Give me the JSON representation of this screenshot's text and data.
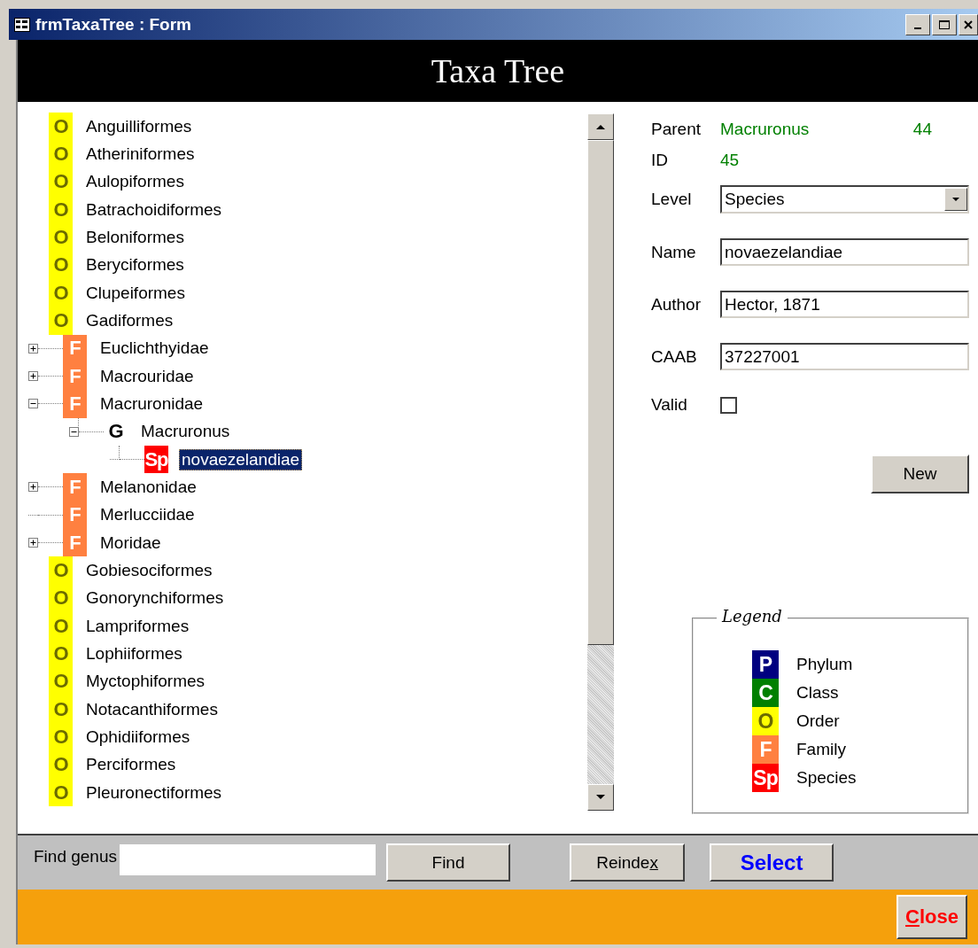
{
  "window": {
    "title": "frmTaxaTree : Form"
  },
  "header": {
    "title": "Taxa Tree"
  },
  "tree": {
    "items": [
      {
        "label": "Anguilliformes",
        "badge": "O",
        "color": "#ffff00",
        "selected": false
      },
      {
        "label": "Atheriniformes",
        "badge": "O",
        "color": "#ffff00",
        "selected": false
      },
      {
        "label": "Aulopiformes",
        "badge": "O",
        "color": "#ffff00",
        "selected": false
      },
      {
        "label": "Batrachoidiformes",
        "badge": "O",
        "color": "#ffff00",
        "selected": false
      },
      {
        "label": "Beloniformes",
        "badge": "O",
        "color": "#ffff00",
        "selected": false
      },
      {
        "label": "Beryciformes",
        "badge": "O",
        "color": "#ffff00",
        "selected": false
      },
      {
        "label": "Clupeiformes",
        "badge": "O",
        "color": "#ffff00",
        "selected": false
      },
      {
        "label": "Gadiformes",
        "badge": "O",
        "color": "#ffff00",
        "selected": false,
        "children": [
          {
            "label": "Euclichthyidae",
            "badge": "F",
            "color": "#ff8040",
            "expanded": false,
            "selected": false
          },
          {
            "label": "Macrouridae",
            "badge": "F",
            "color": "#ff8040",
            "expanded": false,
            "selected": false
          },
          {
            "label": "Macruronidae",
            "badge": "F",
            "color": "#ff8040",
            "expanded": true,
            "selected": false,
            "children": [
              {
                "label": "Macruronus",
                "badge": "G",
                "expanded": true,
                "selected": false,
                "children": [
                  {
                    "label": "novaezelandiae",
                    "badge": "Sp",
                    "color": "#ff0000",
                    "selected": true
                  }
                ]
              }
            ]
          },
          {
            "label": "Melanonidae",
            "badge": "F",
            "color": "#ff8040",
            "expanded": false,
            "selected": false
          },
          {
            "label": "Merlucciidae",
            "badge": "F",
            "color": "#ff8040",
            "selected": false
          },
          {
            "label": "Moridae",
            "badge": "F",
            "color": "#ff8040",
            "expanded": false,
            "selected": false
          }
        ]
      },
      {
        "label": "Gobiesociformes",
        "badge": "O",
        "color": "#ffff00",
        "selected": false
      },
      {
        "label": "Gonorynchiformes",
        "badge": "O",
        "color": "#ffff00",
        "selected": false
      },
      {
        "label": "Lampriformes",
        "badge": "O",
        "color": "#ffff00",
        "selected": false
      },
      {
        "label": "Lophiiformes",
        "badge": "O",
        "color": "#ffff00",
        "selected": false
      },
      {
        "label": "Myctophiformes",
        "badge": "O",
        "color": "#ffff00",
        "selected": false
      },
      {
        "label": "Notacanthiformes",
        "badge": "O",
        "color": "#ffff00",
        "selected": false
      },
      {
        "label": "Ophidiiformes",
        "badge": "O",
        "color": "#ffff00",
        "selected": false
      },
      {
        "label": "Perciformes",
        "badge": "O",
        "color": "#ffff00",
        "selected": false
      },
      {
        "label": "Pleuronectiformes",
        "badge": "O",
        "color": "#ffff00",
        "selected": false
      }
    ]
  },
  "details": {
    "parent": {
      "label": "Parent",
      "name": "Macruronus",
      "id": "44"
    },
    "id": {
      "label": "ID",
      "value": "45"
    },
    "level": {
      "label": "Level",
      "value": "Species"
    },
    "name": {
      "label": "Name",
      "value": "novaezelandiae"
    },
    "author": {
      "label": "Author",
      "value": "Hector, 1871"
    },
    "caab": {
      "label": "CAAB",
      "value": "37227001"
    },
    "valid": {
      "label": "Valid",
      "checked": false
    },
    "new_button": "New"
  },
  "legend": {
    "title": "Legend",
    "items": [
      {
        "badge": "P",
        "label": "Phylum",
        "color": "#000080"
      },
      {
        "badge": "C",
        "label": "Class",
        "color": "#008000"
      },
      {
        "badge": "O",
        "label": "Order",
        "color": "#ffff00"
      },
      {
        "badge": "F",
        "label": "Family",
        "color": "#ff8040"
      },
      {
        "badge": "Sp",
        "label": "Species",
        "color": "#ff0000"
      }
    ]
  },
  "toolbar": {
    "find_label": "Find genus",
    "buttons": [
      {
        "kind": "find",
        "before": "Find"
      },
      {
        "kind": "reindex",
        "before": "Reinde",
        "access_key": "x"
      },
      {
        "kind": "select",
        "before": "Select"
      }
    ]
  },
  "footer": {
    "close": {
      "access_key": "C",
      "after": "lose"
    }
  }
}
